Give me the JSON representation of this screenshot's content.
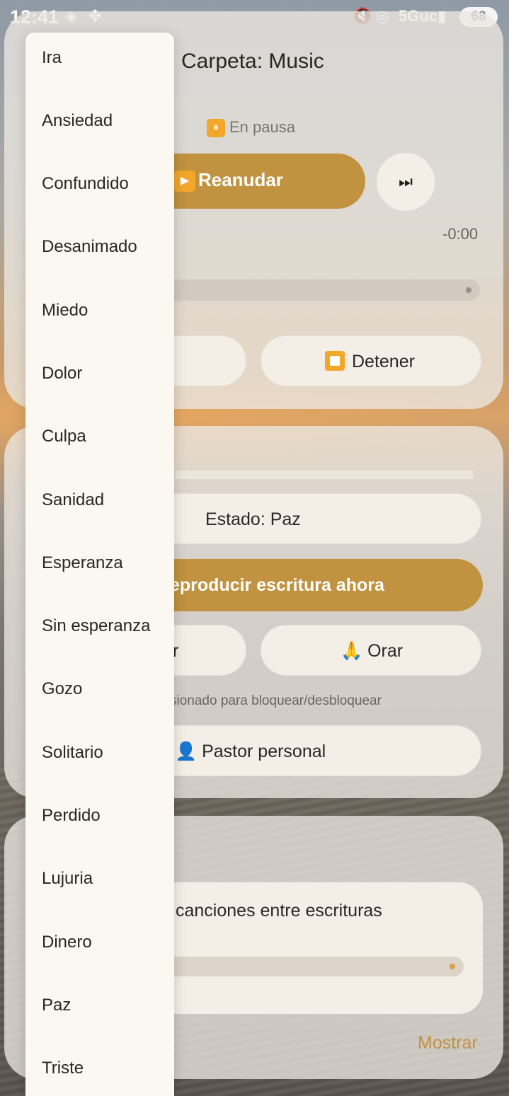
{
  "status_bar": {
    "time": "12:41",
    "network": "5Guc",
    "battery": "68"
  },
  "player": {
    "folder_title": "Carpeta: Music",
    "status_emoji": "⏸",
    "status_text": "En pausa",
    "resume_emoji": "▶",
    "resume_label": "Reanudar",
    "next_icon": "⏭",
    "time_remaining": "-0:00",
    "stop_label": "Detener"
  },
  "scripture": {
    "state_label": "Estado: Paz",
    "play_now_label": "eproducir escritura ahora",
    "left_button_label": "r",
    "pray_emoji": "🙏",
    "pray_label": "Orar",
    "hint": "sionado para bloquear/desbloquear",
    "pastor_emoji": "👤",
    "pastor_label": "Pastor personal"
  },
  "settings": {
    "songs_between_label": "canciones entre escrituras",
    "show_link": "Mostrar"
  },
  "mood_menu": {
    "items": [
      "Ira",
      "Ansiedad",
      "Confundido",
      "Desanimado",
      "Miedo",
      "Dolor",
      "Culpa",
      "Sanidad",
      "Esperanza",
      "Sin esperanza",
      "Gozo",
      "Solitario",
      "Perdido",
      "Lujuria",
      "Dinero",
      "Paz",
      "Triste"
    ]
  },
  "colors": {
    "accent": "#c1923f",
    "card": "#ece8e2",
    "menu_bg": "#fbf7f1"
  }
}
